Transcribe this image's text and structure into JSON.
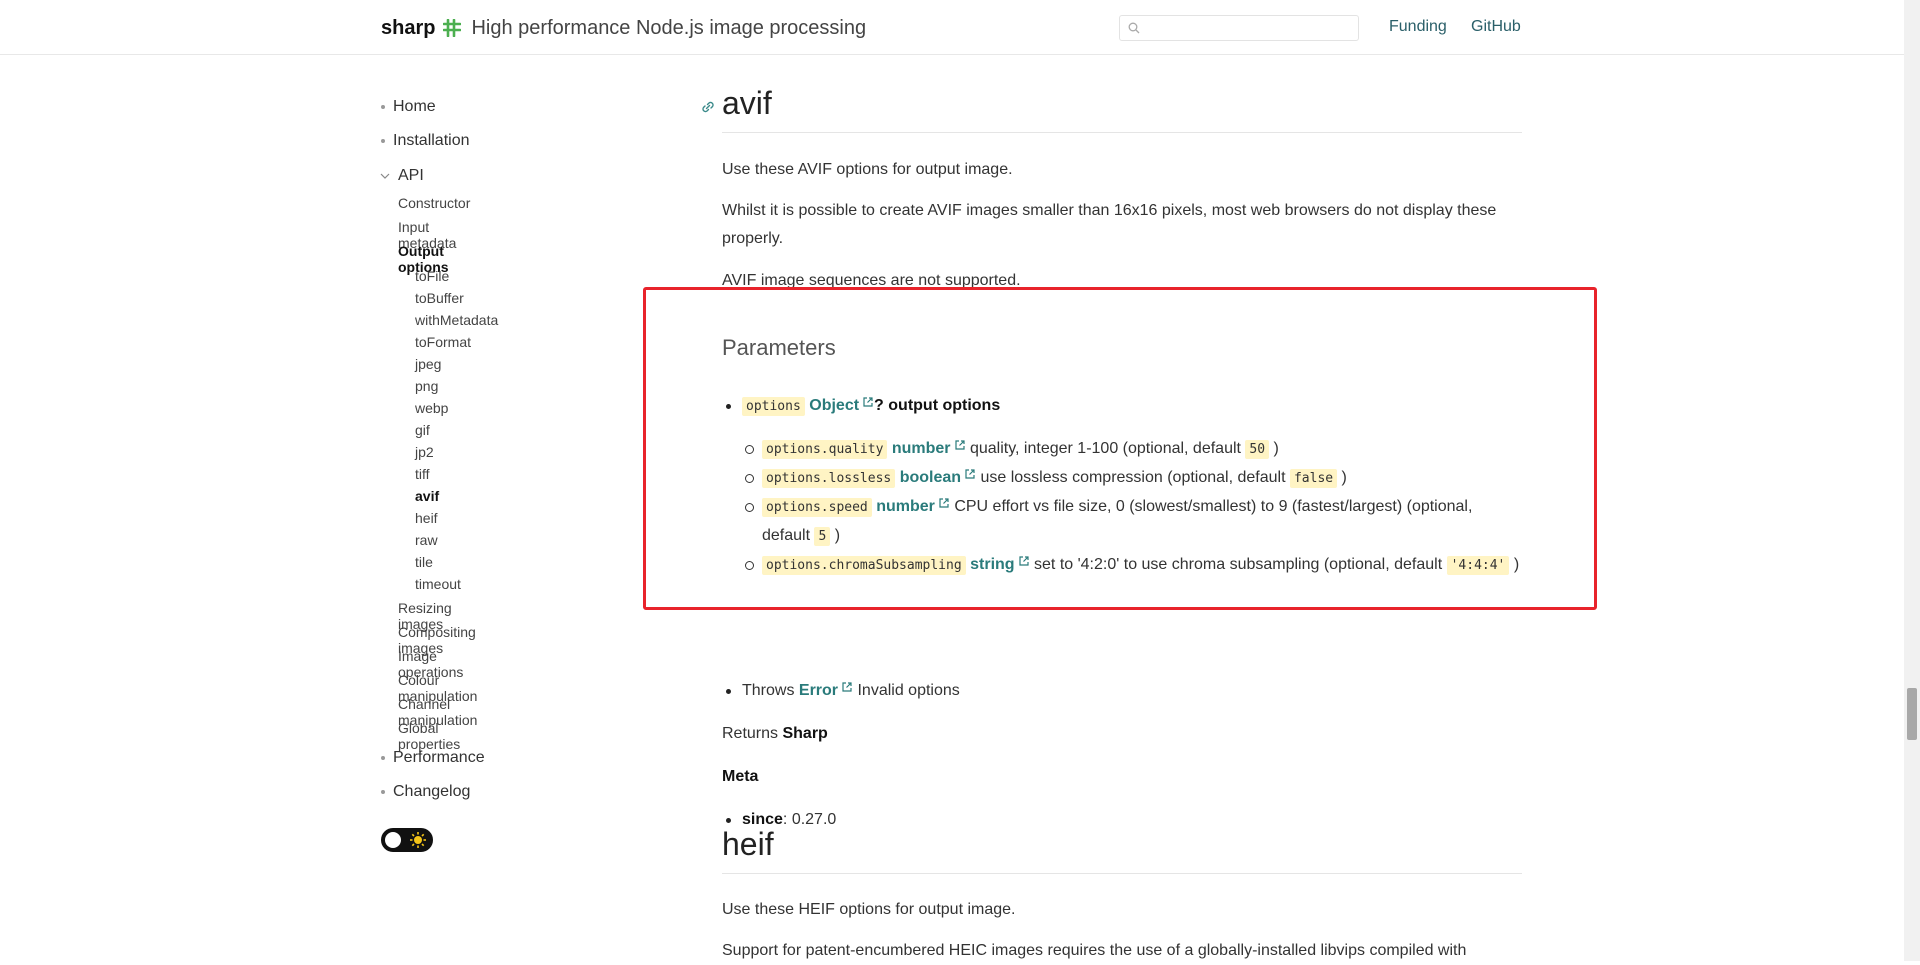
{
  "header": {
    "brand": "sharp",
    "tagline": "High performance Node.js image processing",
    "search_placeholder": "",
    "links": [
      "Funding",
      "GitHub"
    ]
  },
  "sidebar": {
    "home": "Home",
    "installation": "Installation",
    "api": "API",
    "constructor": "Constructor",
    "input_metadata": "Input metadata",
    "output_options": "Output options",
    "output_items": [
      "toFile",
      "toBuffer",
      "withMetadata",
      "toFormat",
      "jpeg",
      "png",
      "webp",
      "gif",
      "jp2",
      "tiff",
      "avif",
      "heif",
      "raw",
      "tile",
      "timeout"
    ],
    "after_items": [
      "Resizing images",
      "Compositing images",
      "Image operations",
      "Colour manipulation",
      "Channel manipulation",
      "Global properties"
    ],
    "performance": "Performance",
    "changelog": "Changelog"
  },
  "main": {
    "avif_title": "avif",
    "avif_p1": "Use these AVIF options for output image.",
    "avif_p2": "Whilst it is possible to create AVIF images smaller than 16x16 pixels, most web browsers do not display these properly.",
    "avif_p3": "AVIF image sequences are not supported.",
    "params_title": "Parameters",
    "options": {
      "code": "options",
      "type": "Object",
      "desc": "? output options"
    },
    "sub": [
      {
        "code": "options.quality",
        "type": "number",
        "desc_before": " quality, integer 1-100 (optional, default ",
        "default": "50",
        "desc_after": " )"
      },
      {
        "code": "options.lossless",
        "type": "boolean",
        "desc_before": " use lossless compression (optional, default ",
        "default": "false",
        "desc_after": " )"
      },
      {
        "code": "options.speed",
        "type": "number",
        "desc_before": " CPU effort vs file size, 0 (slowest/smallest) to 9 (fastest/largest) (optional, default ",
        "default": "5",
        "desc_after": " )"
      },
      {
        "code": "options.chromaSubsampling",
        "type": "string",
        "desc_before": " set to '4:2:0' to use chroma subsampling (optional, default ",
        "default": "'4:4:4'",
        "desc_after": " )"
      }
    ],
    "throws": {
      "label": "Throws",
      "type": "Error",
      "desc": " Invalid options"
    },
    "returns_label": "Returns",
    "returns_value": "Sharp",
    "meta_title": "Meta",
    "since_label": "since",
    "since_value": ": 0.27.0",
    "heif_title": "heif",
    "heif_p1": "Use these HEIF options for output image.",
    "heif_p2": "Support for patent-encumbered HEIC images requires the use of a globally-installed libvips compiled with"
  },
  "colors": {
    "accent": "#2a7b7b",
    "highlight_box": "#e8232b",
    "code_bg": "#fff4c4"
  }
}
